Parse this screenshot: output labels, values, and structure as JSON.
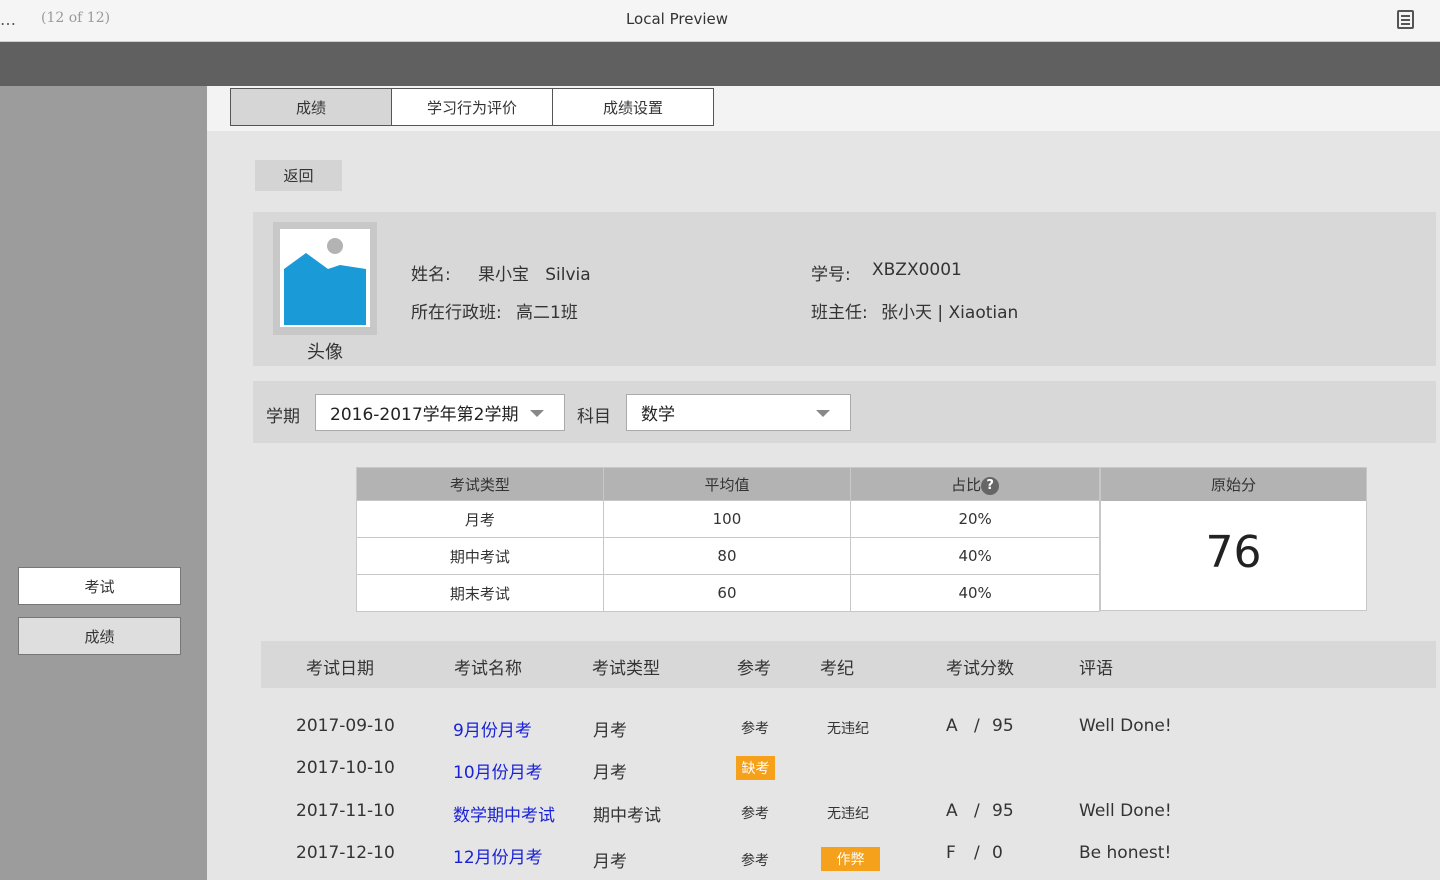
{
  "window": {
    "ellipsis": "…",
    "counter": "(12 of 12)",
    "title": "Local Preview",
    "menu_icon": "document-list-icon"
  },
  "sidebar": {
    "items": [
      {
        "label": "考试"
      },
      {
        "label": "成绩"
      }
    ]
  },
  "tabs": [
    {
      "label": "成绩",
      "active": true
    },
    {
      "label": "学习行为评价",
      "active": false
    },
    {
      "label": "成绩设置",
      "active": false
    }
  ],
  "back_label": "返回",
  "student": {
    "avatar_caption": "头像",
    "name_label": "姓名:",
    "name_value": "果小宝   Silvia",
    "id_label": "学号:",
    "id_value": "XBZX0001",
    "class_label": "所在行政班:",
    "class_value": "高二1班",
    "teacher_label": "班主任:",
    "teacher_value": "张小天 | Xiaotian"
  },
  "filters": {
    "term_label": "学期",
    "term_value": "2016-2017学年第2学期",
    "subject_label": "科目",
    "subject_value": "数学"
  },
  "summary": {
    "headers": [
      "考试类型",
      "平均值",
      "占比"
    ],
    "rows": [
      [
        "月考",
        "100",
        "20%"
      ],
      [
        "期中考试",
        "80",
        "40%"
      ],
      [
        "期末考试",
        "60",
        "40%"
      ]
    ],
    "help_icon": "question-circle-icon",
    "raw_label": "原始分",
    "raw_value": "76"
  },
  "records": {
    "headers": [
      "考试日期",
      "考试名称",
      "考试类型",
      "参考",
      "考纪",
      "考试分数",
      "评语"
    ],
    "rows": [
      {
        "date": "2017-09-10",
        "name": "9月份月考",
        "type": "月考",
        "attend": "参考",
        "attend_badge": false,
        "discipline": "无违纪",
        "discipline_badge": false,
        "grade": "A",
        "sep": "/",
        "score": "95",
        "comment": "Well Done!"
      },
      {
        "date": "2017-10-10",
        "name": "10月份月考",
        "type": "月考",
        "attend": "缺考",
        "attend_badge": true,
        "discipline": "",
        "discipline_badge": false,
        "grade": "",
        "sep": "",
        "score": "",
        "comment": ""
      },
      {
        "date": "2017-11-10",
        "name": "数学期中考试",
        "type": "期中考试",
        "attend": "参考",
        "attend_badge": false,
        "discipline": "无违纪",
        "discipline_badge": false,
        "grade": "A",
        "sep": "/",
        "score": "95",
        "comment": "Well Done!"
      },
      {
        "date": "2017-12-10",
        "name": "12月份月考",
        "type": "月考",
        "attend": "参考",
        "attend_badge": false,
        "discipline": "作弊",
        "discipline_badge": true,
        "grade": "F",
        "sep": "/",
        "score": "0",
        "comment": "Be honest!"
      }
    ],
    "badge_color": "#f5a11c",
    "link_color": "#1a22d6"
  },
  "colors": {
    "sidebar": "#9c9c9c",
    "dark_band": "#606060",
    "avatar_blue": "#1a9ad6"
  }
}
